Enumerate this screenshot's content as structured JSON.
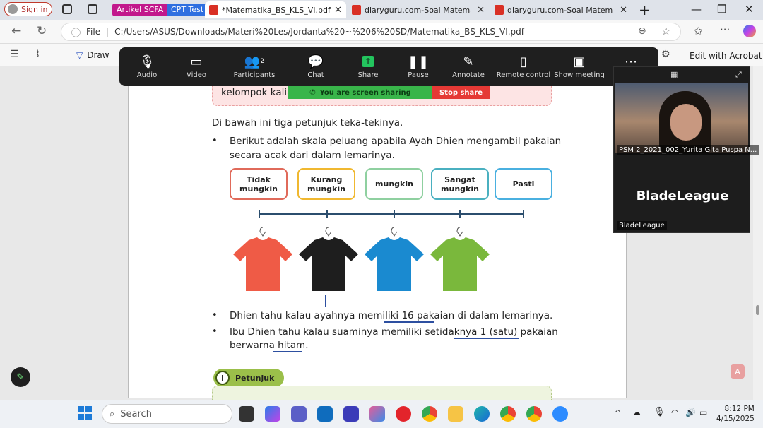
{
  "browser": {
    "signin": "Sign in",
    "bookmarks": [
      {
        "label": "Artikel SCFA",
        "color": "#c2188c"
      },
      {
        "label": "CPT Test",
        "color": "#2f6fe0"
      }
    ],
    "tabs": [
      {
        "label": "*Matematika_BS_KLS_VI.pdf",
        "active": true
      },
      {
        "label": "diaryguru.com-Soal Matematika K",
        "active": false
      },
      {
        "label": "diaryguru.com-Soal Matematika K",
        "active": false
      }
    ],
    "file_label": "File",
    "url": "C:/Users/ASUS/Downloads/Materi%20Les/Jordanta%20~%206%20SD/Matematika_BS_KLS_VI.pdf"
  },
  "pdf_toolbar": {
    "draw": "Draw",
    "edit_acrobat": "Edit with Acrobat"
  },
  "zoom": {
    "items": [
      {
        "label": "Audio",
        "icon": "microphone-icon"
      },
      {
        "label": "Video",
        "icon": "video-icon"
      },
      {
        "label": "Participants",
        "icon": "participants-icon",
        "badge": "2"
      },
      {
        "label": "Chat",
        "icon": "chat-icon"
      },
      {
        "label": "Share",
        "icon": "share-icon"
      },
      {
        "label": "Pause",
        "icon": "pause-icon"
      },
      {
        "label": "Annotate",
        "icon": "pencil-icon"
      },
      {
        "label": "Remote control",
        "icon": "mouse-icon"
      },
      {
        "label": "Show meeting",
        "icon": "show-meeting-icon"
      },
      {
        "label": "More",
        "icon": "more-icon"
      }
    ],
    "sharing": "You are screen sharing",
    "stop": "Stop share"
  },
  "doc": {
    "pink_text": "kelompok kalian",
    "intro": "Di bawah ini tiga petunjuk teka-tekinya.",
    "bullet1_line1": "Berikut adalah skala peluang apabila Ayah Dhien mengambil pakaian",
    "bullet1_line2": "secara acak dari dalam lemarinya.",
    "scale": [
      {
        "l1": "Tidak",
        "l2": "mungkin",
        "color": "#e06a5a"
      },
      {
        "l1": "Kurang",
        "l2": "mungkin",
        "color": "#f0b830"
      },
      {
        "l1": "mungkin",
        "l2": "",
        "color": "#8fd0a0"
      },
      {
        "l1": "Sangat",
        "l2": "mungkin",
        "color": "#4ab0c0"
      },
      {
        "l1": "Pasti",
        "l2": "",
        "color": "#4ab0e0"
      }
    ],
    "shirts": [
      "#ef5b46",
      "#1e1e1e",
      "#1a8ad0",
      "#7ab83c"
    ],
    "bullet2": "Dhien tahu kalau ayahnya memiliki 16 pakaian di dalam lemarinya.",
    "bullet3_line1": "Ibu Dhien tahu kalau suaminya memiliki setidaknya 1 (satu) pakaian",
    "bullet3_line2": "berwarna hitam.",
    "petunjuk": "Petunjuk",
    "petunjuk_icon": "i"
  },
  "webcam": {
    "name1": "PSM 2_2021_002_Yurita Gita Puspa N...",
    "big": "BladeLeague",
    "name2": "BladeLeague"
  },
  "taskbar": {
    "search": "Search",
    "time": "8:12 PM",
    "date": "4/15/2025"
  }
}
